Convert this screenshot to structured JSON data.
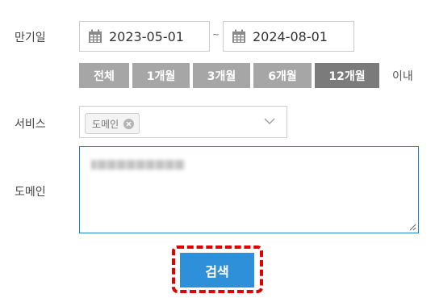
{
  "form": {
    "expiry_label": "만기일",
    "service_label": "서비스",
    "domain_label": "도메인"
  },
  "dates": {
    "start": "2023-05-01",
    "separator": "~",
    "end": "2024-08-01",
    "icon": "calendar-icon"
  },
  "periods": [
    {
      "label": "전체",
      "active": false
    },
    {
      "label": "1개월",
      "active": false
    },
    {
      "label": "3개월",
      "active": false
    },
    {
      "label": "6개월",
      "active": false
    },
    {
      "label": "12개월",
      "active": true
    }
  ],
  "period_suffix": "이내",
  "service_select": {
    "chip_label": "도메인",
    "chip_remove_icon": "remove-icon",
    "dropdown_icon": "chevron-down-icon"
  },
  "domain_textarea": {
    "value_note": "blurred"
  },
  "search_button": {
    "label": "검색",
    "color": "#2e90d8",
    "highlight_color": "#e00000"
  }
}
